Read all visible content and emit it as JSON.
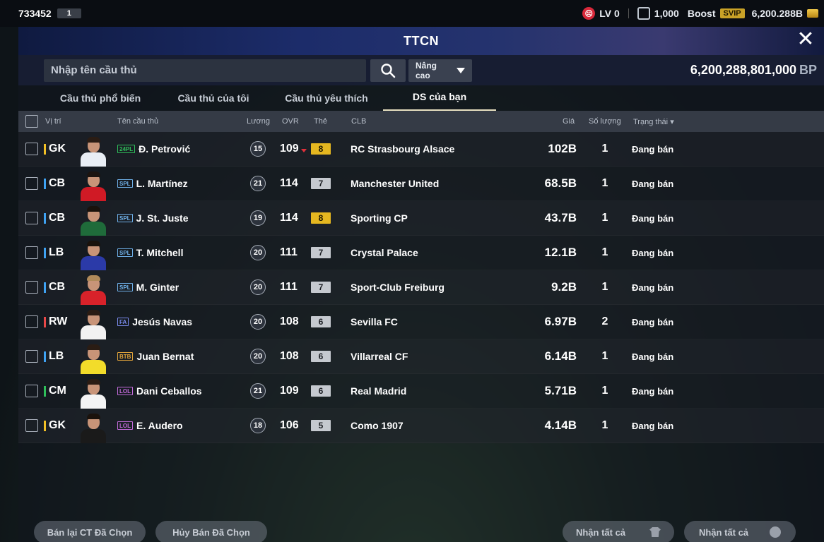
{
  "topbar": {
    "user_id": "733452",
    "user_badge": "1",
    "level": "LV 0",
    "trophy_count": "1,000",
    "boost_label": "Boost",
    "svip_label": "SVIP",
    "currency": "6,200.288B"
  },
  "header": {
    "title": "TTCN"
  },
  "search": {
    "placeholder": "Nhập tên cầu thủ",
    "advanced_label": "Nâng cao",
    "bp_value": "6,200,288,801,000",
    "bp_unit": "BP"
  },
  "tabs": [
    {
      "label": "Cầu thủ phổ biến",
      "active": false
    },
    {
      "label": "Cầu thủ của tôi",
      "active": false
    },
    {
      "label": "Cầu thủ yêu thích",
      "active": false
    },
    {
      "label": "DS của bạn",
      "active": true
    }
  ],
  "columns": {
    "position": "Vị trí",
    "name": "Tên cầu thủ",
    "salary": "Lương",
    "ovr": "OVR",
    "grade": "Thẻ",
    "club": "CLB",
    "price": "Giá",
    "quantity": "Số lượng",
    "status": "Trạng thái"
  },
  "rows": [
    {
      "pos": "GK",
      "pos_color": "#f2c026",
      "season": "24PL",
      "season_color": "#2fbf5a",
      "name": "Đ. Petrović",
      "salary": "15",
      "ovr": "109",
      "ovr_down": true,
      "grade": "8",
      "grade_bg": "#e5b720",
      "grade_fg": "#1a1400",
      "club": "RC Strasbourg Alsace",
      "price": "102B",
      "qty": "1",
      "status": "Đang bán",
      "shirt": "#e9eef5",
      "hair": "#2a1c14"
    },
    {
      "pos": "CB",
      "pos_color": "#3fa2f2",
      "season": "SPL",
      "season_color": "#6fb0e8",
      "name": "L. Martínez",
      "salary": "21",
      "ovr": "114",
      "ovr_down": false,
      "grade": "7",
      "grade_bg": "#c5c9cf",
      "grade_fg": "#1b1e23",
      "club": "Manchester United",
      "price": "68.5B",
      "qty": "1",
      "status": "Đang bán",
      "shirt": "#d01a25",
      "hair": "#1c1410"
    },
    {
      "pos": "CB",
      "pos_color": "#3fa2f2",
      "season": "SPL",
      "season_color": "#6fb0e8",
      "name": "J. St. Juste",
      "salary": "19",
      "ovr": "114",
      "ovr_down": false,
      "grade": "8",
      "grade_bg": "#e5b720",
      "grade_fg": "#1a1400",
      "club": "Sporting CP",
      "price": "43.7B",
      "qty": "1",
      "status": "Đang bán",
      "shirt": "#1f6b3a",
      "hair": "#1a120c"
    },
    {
      "pos": "LB",
      "pos_color": "#3fa2f2",
      "season": "SPL",
      "season_color": "#6fb0e8",
      "name": "T. Mitchell",
      "salary": "20",
      "ovr": "111",
      "ovr_down": false,
      "grade": "7",
      "grade_bg": "#c5c9cf",
      "grade_fg": "#1b1e23",
      "club": "Crystal Palace",
      "price": "12.1B",
      "qty": "1",
      "status": "Đang bán",
      "shirt": "#2b3aa8",
      "hair": "#1a120c"
    },
    {
      "pos": "CB",
      "pos_color": "#3fa2f2",
      "season": "SPL",
      "season_color": "#6fb0e8",
      "name": "M. Ginter",
      "salary": "20",
      "ovr": "111",
      "ovr_down": false,
      "grade": "7",
      "grade_bg": "#c5c9cf",
      "grade_fg": "#1b1e23",
      "club": "Sport-Club Freiburg",
      "price": "9.2B",
      "qty": "1",
      "status": "Đang bán",
      "shirt": "#d8222a",
      "hair": "#b08a5a"
    },
    {
      "pos": "RW",
      "pos_color": "#e84848",
      "season": "FA",
      "season_color": "#7c8df0",
      "name": "Jesús Navas",
      "salary": "20",
      "ovr": "108",
      "ovr_down": false,
      "grade": "6",
      "grade_bg": "#c5c9cf",
      "grade_fg": "#1b1e23",
      "club": "Sevilla FC",
      "price": "6.97B",
      "qty": "2",
      "status": "Đang bán",
      "shirt": "#f2f2f2",
      "hair": "#2a1c14"
    },
    {
      "pos": "LB",
      "pos_color": "#3fa2f2",
      "season": "BTB",
      "season_color": "#e0a33a",
      "name": "Juan Bernat",
      "salary": "20",
      "ovr": "108",
      "ovr_down": false,
      "grade": "6",
      "grade_bg": "#c5c9cf",
      "grade_fg": "#1b1e23",
      "club": "Villarreal CF",
      "price": "6.14B",
      "qty": "1",
      "status": "Đang bán",
      "shirt": "#f2dc2a",
      "hair": "#2a1c14"
    },
    {
      "pos": "CM",
      "pos_color": "#2fbf5a",
      "season": "LOL",
      "season_color": "#c46bdc",
      "name": "Dani Ceballos",
      "salary": "21",
      "ovr": "109",
      "ovr_down": false,
      "grade": "6",
      "grade_bg": "#c5c9cf",
      "grade_fg": "#1b1e23",
      "club": "Real Madrid",
      "price": "5.71B",
      "qty": "1",
      "status": "Đang bán",
      "shirt": "#f4f4f4",
      "hair": "#2a1c14"
    },
    {
      "pos": "GK",
      "pos_color": "#f2c026",
      "season": "LOL",
      "season_color": "#c46bdc",
      "name": "E. Audero",
      "salary": "18",
      "ovr": "106",
      "ovr_down": false,
      "grade": "5",
      "grade_bg": "#c5c9cf",
      "grade_fg": "#1b1e23",
      "club": "Como 1907",
      "price": "4.14B",
      "qty": "1",
      "status": "Đang bán",
      "shirt": "#1a1a1a",
      "hair": "#1a120c"
    }
  ],
  "bottom": {
    "resell_label": "Bán lại CT Đã Chọn",
    "cancel_label": "Hủy Bán Đã Chọn",
    "claim_all_1": "Nhận tất cả",
    "claim_all_2": "Nhận tất cả"
  }
}
